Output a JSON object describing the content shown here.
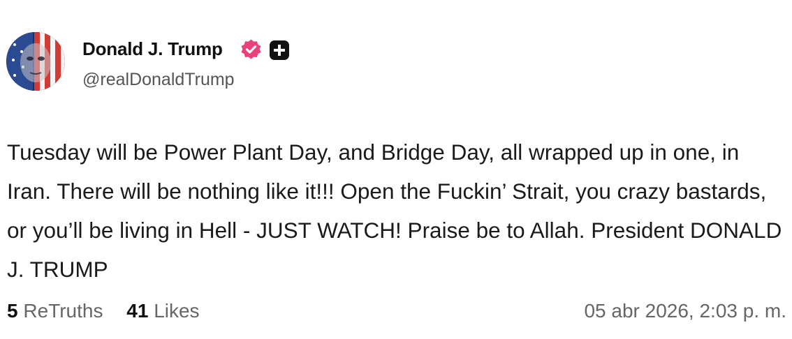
{
  "author": {
    "display_name": "Donald J. Trump",
    "handle": "@realDonaldTrump",
    "avatar_icon": "flag-portrait-avatar",
    "verified_icon": "verified-badge-icon",
    "verified_color": "#e9417a",
    "plus_icon": "plus-badge-icon"
  },
  "post": {
    "text": "Tuesday will be Power Plant Day, and Bridge Day, all wrapped up in one, in Iran. There will be nothing like it!!! Open the Fuckin’ Strait, you crazy bastards, or you’ll be living in Hell - JUST WATCH! Praise be to Allah. President DONALD J. TRUMP"
  },
  "stats": {
    "retruths_count": "5",
    "retruths_label": "ReTruths",
    "likes_count": "41",
    "likes_label": "Likes"
  },
  "timestamp": "05 abr 2026, 2:03 p. m."
}
